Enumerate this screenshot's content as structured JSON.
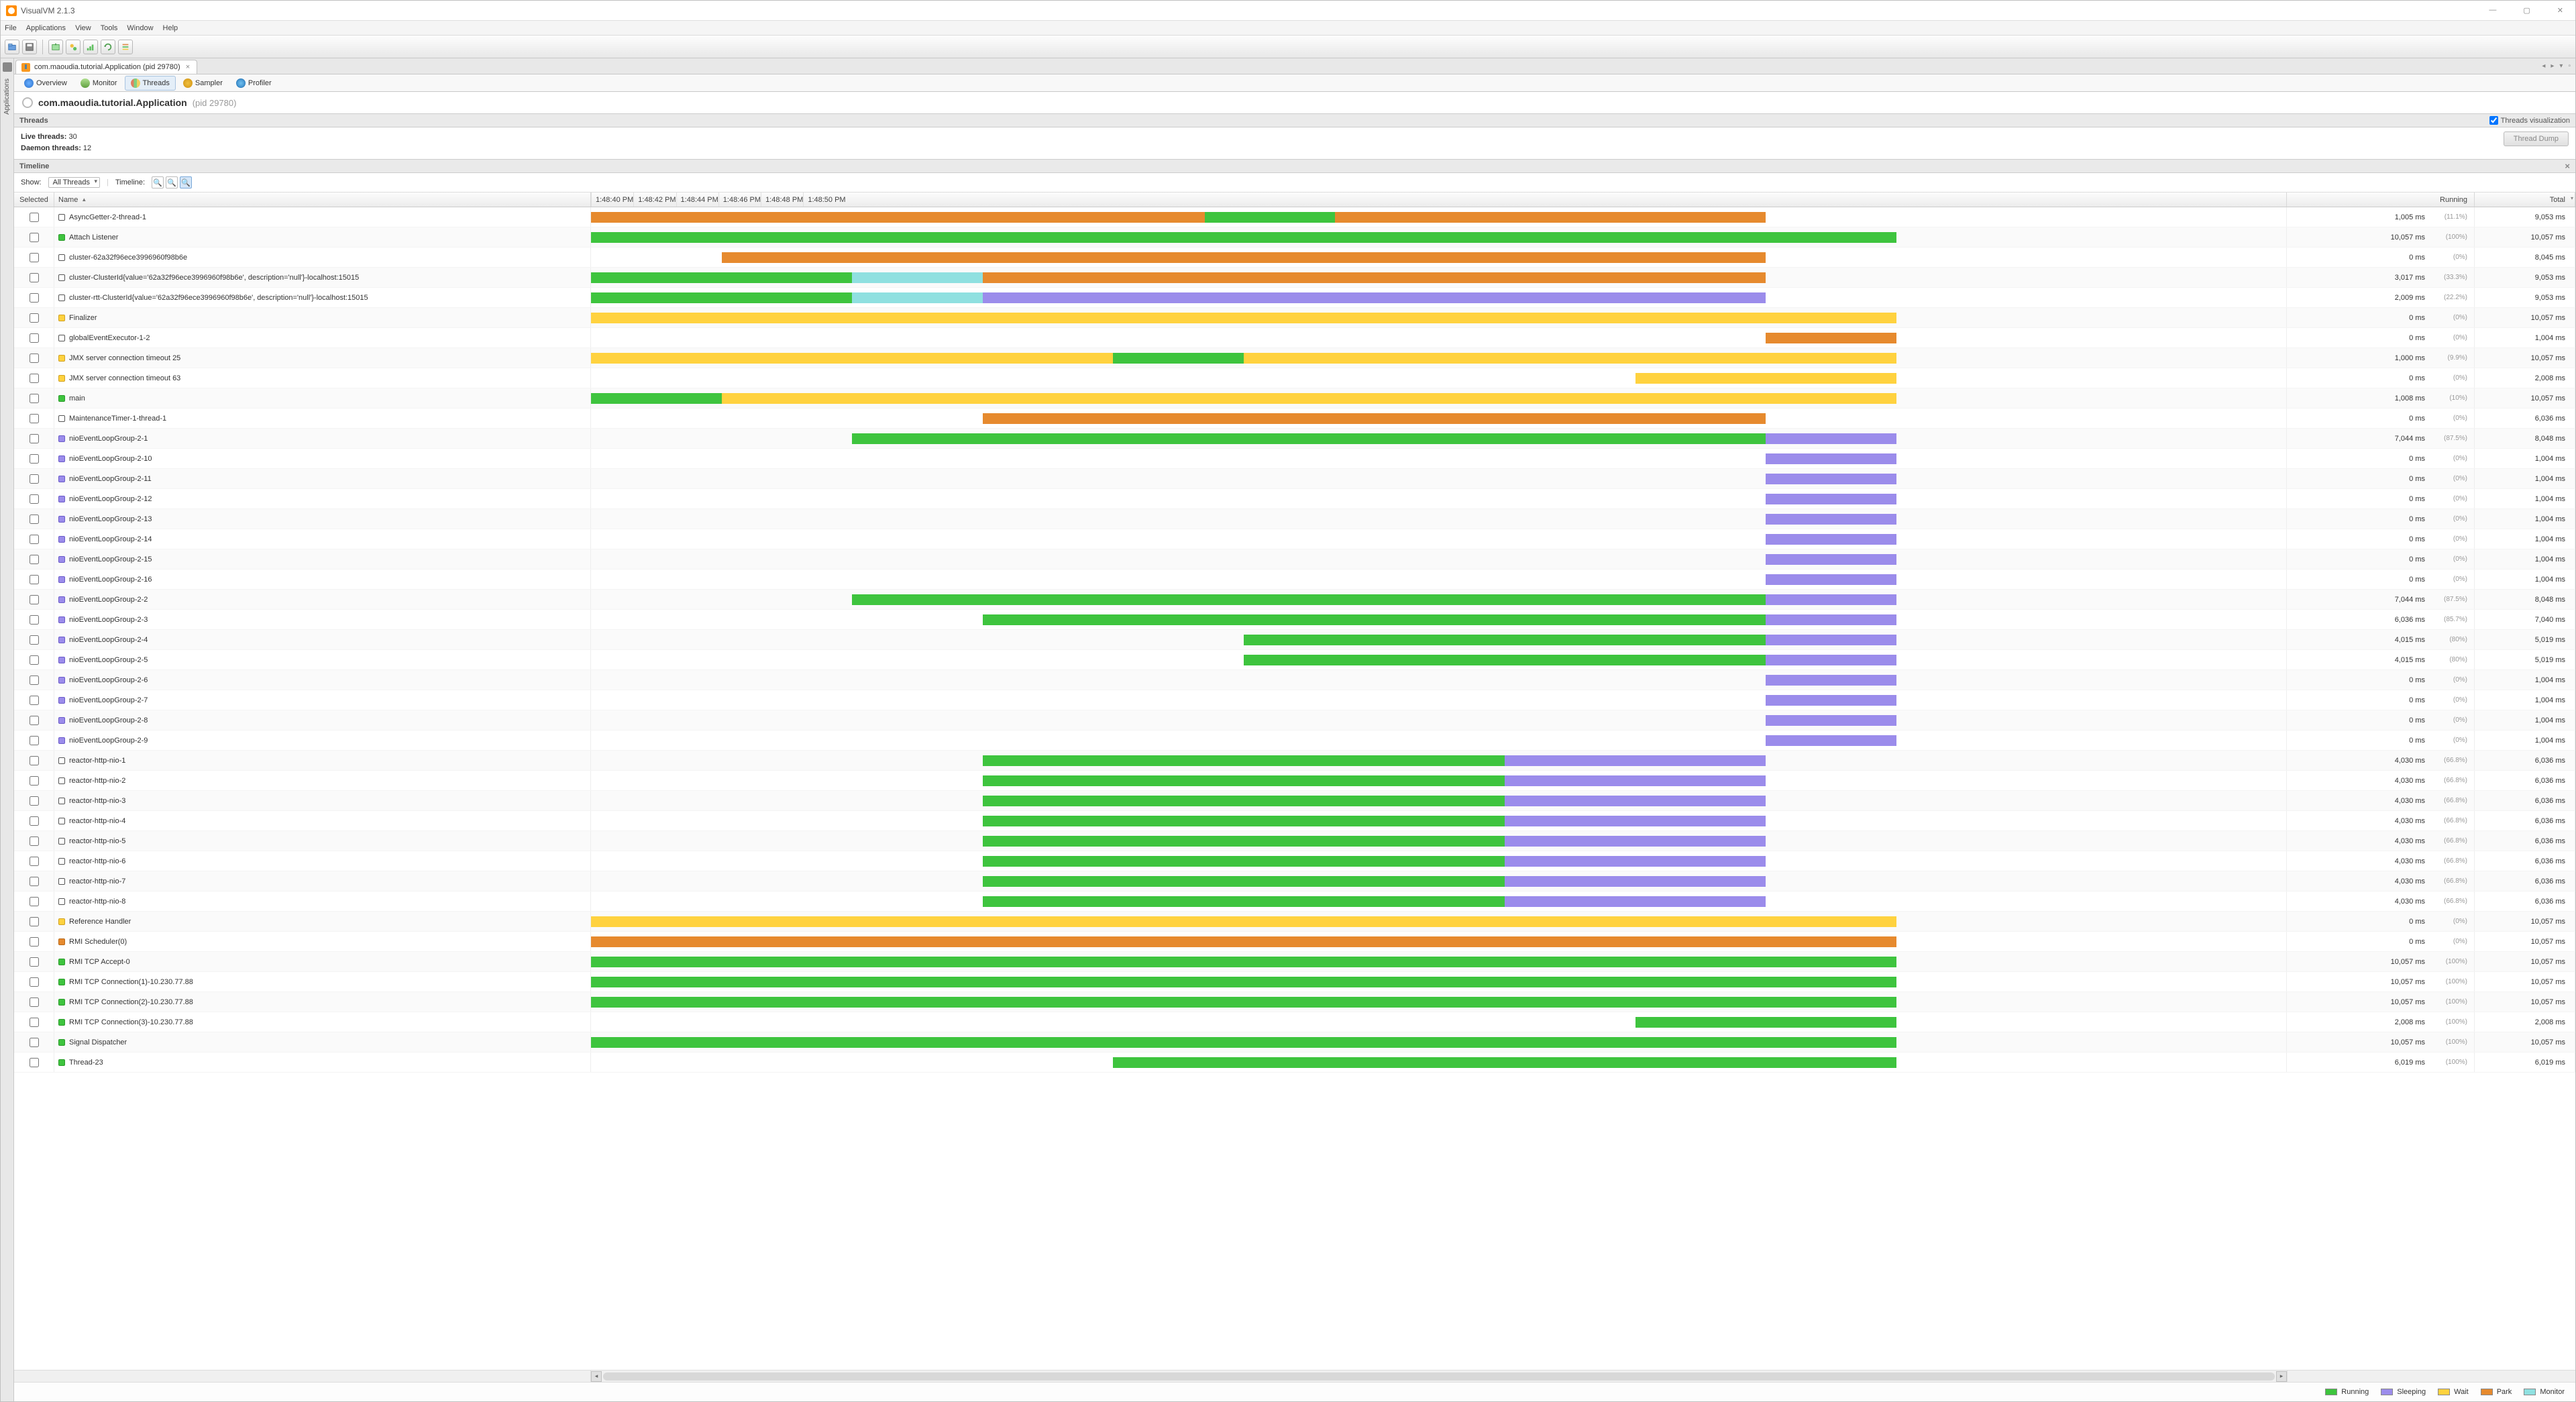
{
  "window": {
    "title": "VisualVM 2.1.3"
  },
  "menu": [
    "File",
    "Applications",
    "View",
    "Tools",
    "Window",
    "Help"
  ],
  "tab": {
    "label": "com.maoudia.tutorial.Application (pid 29780)"
  },
  "subtabs": [
    "Overview",
    "Monitor",
    "Threads",
    "Sampler",
    "Profiler"
  ],
  "app": {
    "name": "com.maoudia.tutorial.Application",
    "pid": "(pid 29780)"
  },
  "section": {
    "threads": "Threads",
    "viz_checkbox": "Threads visualization",
    "timeline": "Timeline"
  },
  "stats": {
    "live_label": "Live threads:",
    "live_val": "30",
    "daemon_label": "Daemon threads:",
    "daemon_val": "12",
    "thread_dump": "Thread Dump"
  },
  "timeline_ctrl": {
    "show": "Show:",
    "show_value": "All Threads",
    "timeline_label": "Timeline:"
  },
  "columns": {
    "selected": "Selected",
    "name": "Name",
    "running": "Running",
    "total": "Total"
  },
  "time_ticks": [
    "1:48:40 PM",
    "1:48:42 PM",
    "1:48:44 PM",
    "1:48:46 PM",
    "1:48:48 PM",
    "1:48:50 PM"
  ],
  "legend": {
    "running": "Running",
    "sleeping": "Sleeping",
    "wait": "Wait",
    "park": "Park",
    "monitor": "Monitor"
  },
  "colors": {
    "running": "#3EC43E",
    "sleeping": "#9B8CEB",
    "wait": "#FFD23F",
    "park": "#E68A2E",
    "monitor": "#8FE0E0"
  },
  "timeline_span_pct": 77,
  "threads": [
    {
      "name": "AsyncGetter-2-thread-1",
      "marker": "none",
      "running": "1,005 ms",
      "pct": "(11.1%)",
      "total": "9,053 ms",
      "bars": [
        {
          "s": "park",
          "l": 0,
          "w": 47
        },
        {
          "s": "running",
          "l": 47,
          "w": 10
        },
        {
          "s": "park",
          "l": 57,
          "w": 33
        }
      ]
    },
    {
      "name": "Attach Listener",
      "marker": "running",
      "running": "10,057 ms",
      "pct": "(100%)",
      "total": "10,057 ms",
      "bars": [
        {
          "s": "running",
          "l": 0,
          "w": 100
        }
      ]
    },
    {
      "name": "cluster-62a32f96ece3996960f98b6e",
      "marker": "none",
      "running": "0 ms",
      "pct": "(0%)",
      "total": "8,045 ms",
      "bars": [
        {
          "s": "park",
          "l": 10,
          "w": 80
        }
      ]
    },
    {
      "name": "cluster-ClusterId{value='62a32f96ece3996960f98b6e', description='null'}-localhost:15015",
      "marker": "none",
      "running": "3,017 ms",
      "pct": "(33.3%)",
      "total": "9,053 ms",
      "bars": [
        {
          "s": "running",
          "l": 0,
          "w": 20
        },
        {
          "s": "monitor",
          "l": 20,
          "w": 10
        },
        {
          "s": "park",
          "l": 30,
          "w": 60
        }
      ]
    },
    {
      "name": "cluster-rtt-ClusterId{value='62a32f96ece3996960f98b6e', description='null'}-localhost:15015",
      "marker": "none",
      "running": "2,009 ms",
      "pct": "(22.2%)",
      "total": "9,053 ms",
      "bars": [
        {
          "s": "running",
          "l": 0,
          "w": 20
        },
        {
          "s": "monitor",
          "l": 20,
          "w": 10
        },
        {
          "s": "sleeping",
          "l": 30,
          "w": 60
        }
      ]
    },
    {
      "name": "Finalizer",
      "marker": "wait",
      "running": "0 ms",
      "pct": "(0%)",
      "total": "10,057 ms",
      "bars": [
        {
          "s": "wait",
          "l": 0,
          "w": 100
        }
      ]
    },
    {
      "name": "globalEventExecutor-1-2",
      "marker": "none",
      "running": "0 ms",
      "pct": "(0%)",
      "total": "1,004 ms",
      "bars": [
        {
          "s": "park",
          "l": 90,
          "w": 10
        }
      ]
    },
    {
      "name": "JMX server connection timeout 25",
      "marker": "wait",
      "running": "1,000 ms",
      "pct": "(9.9%)",
      "total": "10,057 ms",
      "bars": [
        {
          "s": "wait",
          "l": 0,
          "w": 40
        },
        {
          "s": "running",
          "l": 40,
          "w": 10
        },
        {
          "s": "wait",
          "l": 50,
          "w": 50
        }
      ]
    },
    {
      "name": "JMX server connection timeout 63",
      "marker": "wait",
      "running": "0 ms",
      "pct": "(0%)",
      "total": "2,008 ms",
      "bars": [
        {
          "s": "wait",
          "l": 80,
          "w": 20
        }
      ]
    },
    {
      "name": "main",
      "marker": "running",
      "running": "1,008 ms",
      "pct": "(10%)",
      "total": "10,057 ms",
      "bars": [
        {
          "s": "running",
          "l": 0,
          "w": 10
        },
        {
          "s": "wait",
          "l": 10,
          "w": 90
        }
      ]
    },
    {
      "name": "MaintenanceTimer-1-thread-1",
      "marker": "none",
      "running": "0 ms",
      "pct": "(0%)",
      "total": "6,036 ms",
      "bars": [
        {
          "s": "park",
          "l": 30,
          "w": 60
        }
      ]
    },
    {
      "name": "nioEventLoopGroup-2-1",
      "marker": "sleeping",
      "running": "7,044 ms",
      "pct": "(87.5%)",
      "total": "8,048 ms",
      "bars": [
        {
          "s": "running",
          "l": 20,
          "w": 70
        },
        {
          "s": "sleeping",
          "l": 90,
          "w": 10
        }
      ]
    },
    {
      "name": "nioEventLoopGroup-2-10",
      "marker": "sleeping",
      "running": "0 ms",
      "pct": "(0%)",
      "total": "1,004 ms",
      "bars": [
        {
          "s": "sleeping",
          "l": 90,
          "w": 10
        }
      ]
    },
    {
      "name": "nioEventLoopGroup-2-11",
      "marker": "sleeping",
      "running": "0 ms",
      "pct": "(0%)",
      "total": "1,004 ms",
      "bars": [
        {
          "s": "sleeping",
          "l": 90,
          "w": 10
        }
      ]
    },
    {
      "name": "nioEventLoopGroup-2-12",
      "marker": "sleeping",
      "running": "0 ms",
      "pct": "(0%)",
      "total": "1,004 ms",
      "bars": [
        {
          "s": "sleeping",
          "l": 90,
          "w": 10
        }
      ]
    },
    {
      "name": "nioEventLoopGroup-2-13",
      "marker": "sleeping",
      "running": "0 ms",
      "pct": "(0%)",
      "total": "1,004 ms",
      "bars": [
        {
          "s": "sleeping",
          "l": 90,
          "w": 10
        }
      ]
    },
    {
      "name": "nioEventLoopGroup-2-14",
      "marker": "sleeping",
      "running": "0 ms",
      "pct": "(0%)",
      "total": "1,004 ms",
      "bars": [
        {
          "s": "sleeping",
          "l": 90,
          "w": 10
        }
      ]
    },
    {
      "name": "nioEventLoopGroup-2-15",
      "marker": "sleeping",
      "running": "0 ms",
      "pct": "(0%)",
      "total": "1,004 ms",
      "bars": [
        {
          "s": "sleeping",
          "l": 90,
          "w": 10
        }
      ]
    },
    {
      "name": "nioEventLoopGroup-2-16",
      "marker": "sleeping",
      "running": "0 ms",
      "pct": "(0%)",
      "total": "1,004 ms",
      "bars": [
        {
          "s": "sleeping",
          "l": 90,
          "w": 10
        }
      ]
    },
    {
      "name": "nioEventLoopGroup-2-2",
      "marker": "sleeping",
      "running": "7,044 ms",
      "pct": "(87.5%)",
      "total": "8,048 ms",
      "bars": [
        {
          "s": "running",
          "l": 20,
          "w": 70
        },
        {
          "s": "sleeping",
          "l": 90,
          "w": 10
        }
      ]
    },
    {
      "name": "nioEventLoopGroup-2-3",
      "marker": "sleeping",
      "running": "6,036 ms",
      "pct": "(85.7%)",
      "total": "7,040 ms",
      "bars": [
        {
          "s": "running",
          "l": 30,
          "w": 60
        },
        {
          "s": "sleeping",
          "l": 90,
          "w": 10
        }
      ]
    },
    {
      "name": "nioEventLoopGroup-2-4",
      "marker": "sleeping",
      "running": "4,015 ms",
      "pct": "(80%)",
      "total": "5,019 ms",
      "bars": [
        {
          "s": "running",
          "l": 50,
          "w": 40
        },
        {
          "s": "sleeping",
          "l": 90,
          "w": 10
        }
      ]
    },
    {
      "name": "nioEventLoopGroup-2-5",
      "marker": "sleeping",
      "running": "4,015 ms",
      "pct": "(80%)",
      "total": "5,019 ms",
      "bars": [
        {
          "s": "running",
          "l": 50,
          "w": 40
        },
        {
          "s": "sleeping",
          "l": 90,
          "w": 10
        }
      ]
    },
    {
      "name": "nioEventLoopGroup-2-6",
      "marker": "sleeping",
      "running": "0 ms",
      "pct": "(0%)",
      "total": "1,004 ms",
      "bars": [
        {
          "s": "sleeping",
          "l": 90,
          "w": 10
        }
      ]
    },
    {
      "name": "nioEventLoopGroup-2-7",
      "marker": "sleeping",
      "running": "0 ms",
      "pct": "(0%)",
      "total": "1,004 ms",
      "bars": [
        {
          "s": "sleeping",
          "l": 90,
          "w": 10
        }
      ]
    },
    {
      "name": "nioEventLoopGroup-2-8",
      "marker": "sleeping",
      "running": "0 ms",
      "pct": "(0%)",
      "total": "1,004 ms",
      "bars": [
        {
          "s": "sleeping",
          "l": 90,
          "w": 10
        }
      ]
    },
    {
      "name": "nioEventLoopGroup-2-9",
      "marker": "sleeping",
      "running": "0 ms",
      "pct": "(0%)",
      "total": "1,004 ms",
      "bars": [
        {
          "s": "sleeping",
          "l": 90,
          "w": 10
        }
      ]
    },
    {
      "name": "reactor-http-nio-1",
      "marker": "none",
      "running": "4,030 ms",
      "pct": "(66.8%)",
      "total": "6,036 ms",
      "bars": [
        {
          "s": "running",
          "l": 30,
          "w": 40
        },
        {
          "s": "sleeping",
          "l": 70,
          "w": 20
        }
      ]
    },
    {
      "name": "reactor-http-nio-2",
      "marker": "none",
      "running": "4,030 ms",
      "pct": "(66.8%)",
      "total": "6,036 ms",
      "bars": [
        {
          "s": "running",
          "l": 30,
          "w": 40
        },
        {
          "s": "sleeping",
          "l": 70,
          "w": 20
        }
      ]
    },
    {
      "name": "reactor-http-nio-3",
      "marker": "none",
      "running": "4,030 ms",
      "pct": "(66.8%)",
      "total": "6,036 ms",
      "bars": [
        {
          "s": "running",
          "l": 30,
          "w": 40
        },
        {
          "s": "sleeping",
          "l": 70,
          "w": 20
        }
      ]
    },
    {
      "name": "reactor-http-nio-4",
      "marker": "none",
      "running": "4,030 ms",
      "pct": "(66.8%)",
      "total": "6,036 ms",
      "bars": [
        {
          "s": "running",
          "l": 30,
          "w": 40
        },
        {
          "s": "sleeping",
          "l": 70,
          "w": 20
        }
      ]
    },
    {
      "name": "reactor-http-nio-5",
      "marker": "none",
      "running": "4,030 ms",
      "pct": "(66.8%)",
      "total": "6,036 ms",
      "bars": [
        {
          "s": "running",
          "l": 30,
          "w": 40
        },
        {
          "s": "sleeping",
          "l": 70,
          "w": 20
        }
      ]
    },
    {
      "name": "reactor-http-nio-6",
      "marker": "none",
      "running": "4,030 ms",
      "pct": "(66.8%)",
      "total": "6,036 ms",
      "bars": [
        {
          "s": "running",
          "l": 30,
          "w": 40
        },
        {
          "s": "sleeping",
          "l": 70,
          "w": 20
        }
      ]
    },
    {
      "name": "reactor-http-nio-7",
      "marker": "none",
      "running": "4,030 ms",
      "pct": "(66.8%)",
      "total": "6,036 ms",
      "bars": [
        {
          "s": "running",
          "l": 30,
          "w": 40
        },
        {
          "s": "sleeping",
          "l": 70,
          "w": 20
        }
      ]
    },
    {
      "name": "reactor-http-nio-8",
      "marker": "none",
      "running": "4,030 ms",
      "pct": "(66.8%)",
      "total": "6,036 ms",
      "bars": [
        {
          "s": "running",
          "l": 30,
          "w": 40
        },
        {
          "s": "sleeping",
          "l": 70,
          "w": 20
        }
      ]
    },
    {
      "name": "Reference Handler",
      "marker": "wait",
      "running": "0 ms",
      "pct": "(0%)",
      "total": "10,057 ms",
      "bars": [
        {
          "s": "wait",
          "l": 0,
          "w": 100
        }
      ]
    },
    {
      "name": "RMI Scheduler(0)",
      "marker": "park",
      "running": "0 ms",
      "pct": "(0%)",
      "total": "10,057 ms",
      "bars": [
        {
          "s": "park",
          "l": 0,
          "w": 100
        }
      ]
    },
    {
      "name": "RMI TCP Accept-0",
      "marker": "running",
      "running": "10,057 ms",
      "pct": "(100%)",
      "total": "10,057 ms",
      "bars": [
        {
          "s": "running",
          "l": 0,
          "w": 100
        }
      ]
    },
    {
      "name": "RMI TCP Connection(1)-10.230.77.88",
      "marker": "running",
      "running": "10,057 ms",
      "pct": "(100%)",
      "total": "10,057 ms",
      "bars": [
        {
          "s": "running",
          "l": 0,
          "w": 100
        }
      ]
    },
    {
      "name": "RMI TCP Connection(2)-10.230.77.88",
      "marker": "running",
      "running": "10,057 ms",
      "pct": "(100%)",
      "total": "10,057 ms",
      "bars": [
        {
          "s": "running",
          "l": 0,
          "w": 100
        }
      ]
    },
    {
      "name": "RMI TCP Connection(3)-10.230.77.88",
      "marker": "running",
      "running": "2,008 ms",
      "pct": "(100%)",
      "total": "2,008 ms",
      "bars": [
        {
          "s": "running",
          "l": 80,
          "w": 20
        }
      ]
    },
    {
      "name": "Signal Dispatcher",
      "marker": "running",
      "running": "10,057 ms",
      "pct": "(100%)",
      "total": "10,057 ms",
      "bars": [
        {
          "s": "running",
          "l": 0,
          "w": 100
        }
      ]
    },
    {
      "name": "Thread-23",
      "marker": "running",
      "running": "6,019 ms",
      "pct": "(100%)",
      "total": "6,019 ms",
      "bars": [
        {
          "s": "running",
          "l": 40,
          "w": 60
        }
      ]
    }
  ]
}
